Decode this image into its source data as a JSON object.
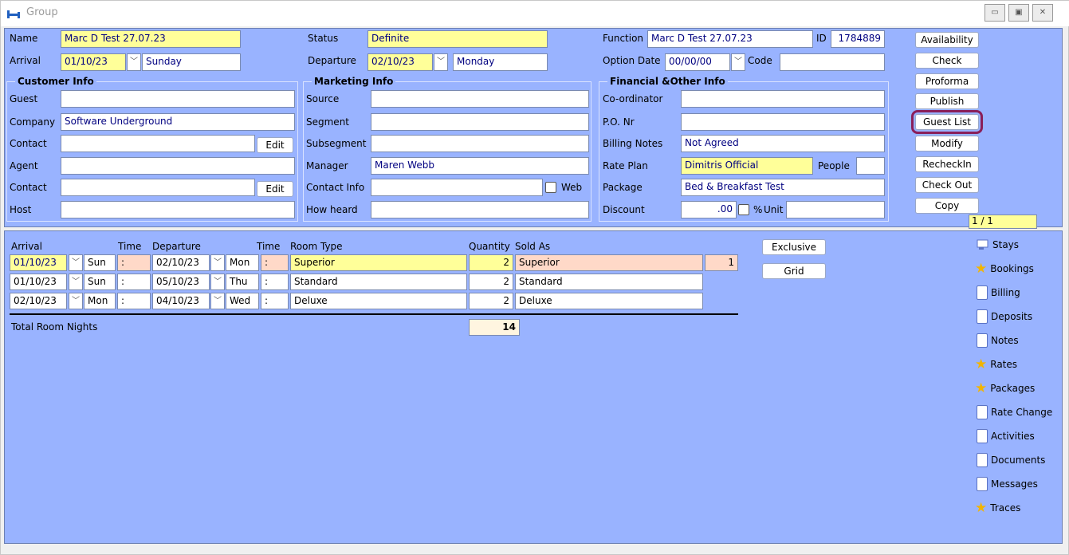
{
  "window": {
    "title": "Group"
  },
  "header": {
    "name_label": "Name",
    "name_value": "Marc D Test 27.07.23",
    "status_label": "Status",
    "status_value": "Definite",
    "function_label": "Function",
    "function_value": "Marc D Test 27.07.23",
    "id_label": "ID",
    "id_value": "1784889",
    "arrival_label": "Arrival",
    "arrival_date": "01/10/23",
    "arrival_day": "Sunday",
    "departure_label": "Departure",
    "departure_date": "02/10/23",
    "departure_day": "Monday",
    "option_date_label": "Option Date",
    "option_date_value": "00/00/00",
    "code_label": "Code",
    "code_value": ""
  },
  "customer_info": {
    "title": "Customer Info",
    "guest_label": "Guest",
    "guest_value": "",
    "company_label": "Company",
    "company_value": "Software Underground",
    "contact_label": "Contact",
    "contact_value": "",
    "contact_edit": "Edit",
    "agent_label": "Agent",
    "agent_value": "",
    "agent_contact_label": "Contact",
    "agent_contact_value": "",
    "agent_contact_edit": "Edit",
    "host_label": "Host",
    "host_value": ""
  },
  "marketing_info": {
    "title": "Marketing Info",
    "source_label": "Source",
    "source_value": "",
    "segment_label": "Segment",
    "segment_value": "",
    "subsegment_label": "Subsegment",
    "subsegment_value": "",
    "manager_label": "Manager",
    "manager_value": "Maren  Webb",
    "contact_info_label": "Contact Info",
    "contact_info_value": "",
    "web_label": "Web",
    "how_heard_label": "How heard",
    "how_heard_value": ""
  },
  "financial_info": {
    "title": "Financial &Other Info",
    "coordinator_label": "Co-ordinator",
    "coordinator_value": "",
    "po_label": "P.O. Nr",
    "po_value": "",
    "billing_notes_label": "Billing Notes",
    "billing_notes_value": "Not Agreed",
    "rate_plan_label": "Rate Plan",
    "rate_plan_value": "Dimitris Official",
    "people_label": "People",
    "people_value": "",
    "package_label": "Package",
    "package_value": "Bed & Breakfast Test",
    "discount_label": "Discount",
    "discount_value": ".00",
    "percent_label": "%",
    "unit_label": "Unit",
    "unit_value": ""
  },
  "actions": {
    "availability": "Availability",
    "check": "Check",
    "proforma": "Proforma",
    "publish": "Publish",
    "guest_list": "Guest List",
    "modify": "Modify",
    "recheckin": "RecheckIn",
    "check_out": "Check Out",
    "copy": "Copy"
  },
  "pager": "1 / 1",
  "stays": {
    "headers": {
      "arrival": "Arrival",
      "time": "Time",
      "departure": "Departure",
      "time2": "Time",
      "room_type": "Room Type",
      "quantity": "Quantity",
      "sold_as": "Sold As"
    },
    "rows": [
      {
        "arrival": "01/10/23",
        "arr_day": "Sun",
        "arr_time": ":",
        "departure": "02/10/23",
        "dep_day": "Mon",
        "dep_time": ":",
        "room_type": "Superior",
        "quantity": "2",
        "sold_as": "Superior",
        "extra": "1"
      },
      {
        "arrival": "01/10/23",
        "arr_day": "Sun",
        "arr_time": ":",
        "departure": "05/10/23",
        "dep_day": "Thu",
        "dep_time": ":",
        "room_type": "Standard",
        "quantity": "2",
        "sold_as": "Standard",
        "extra": ""
      },
      {
        "arrival": "02/10/23",
        "arr_day": "Mon",
        "arr_time": ":",
        "departure": "04/10/23",
        "dep_day": "Wed",
        "dep_time": ":",
        "room_type": "Deluxe",
        "quantity": "2",
        "sold_as": "Deluxe",
        "extra": ""
      }
    ],
    "total_label": "Total Room Nights",
    "total_value": "14",
    "exclusive_button": "Exclusive",
    "grid_button": "Grid"
  },
  "sidebar": {
    "items": [
      {
        "label": "Stays",
        "icon": "stays-icon"
      },
      {
        "label": "Bookings",
        "icon": "star-icon"
      },
      {
        "label": "Billing",
        "icon": "document-icon"
      },
      {
        "label": "Deposits",
        "icon": "document-icon"
      },
      {
        "label": "Notes",
        "icon": "document-icon"
      },
      {
        "label": "Rates",
        "icon": "star-icon"
      },
      {
        "label": "Packages",
        "icon": "star-icon"
      },
      {
        "label": "Rate Change",
        "icon": "document-icon"
      },
      {
        "label": "Activities",
        "icon": "document-icon"
      },
      {
        "label": "Documents",
        "icon": "document-icon"
      },
      {
        "label": "Messages",
        "icon": "document-icon"
      },
      {
        "label": "Traces",
        "icon": "star-icon"
      }
    ]
  },
  "colors": {
    "panel": "#99b3ff",
    "required_field": "#ffff99",
    "sold_as_highlight": "#ffd9c8",
    "guest_list_outline": "#8a1f5a"
  }
}
